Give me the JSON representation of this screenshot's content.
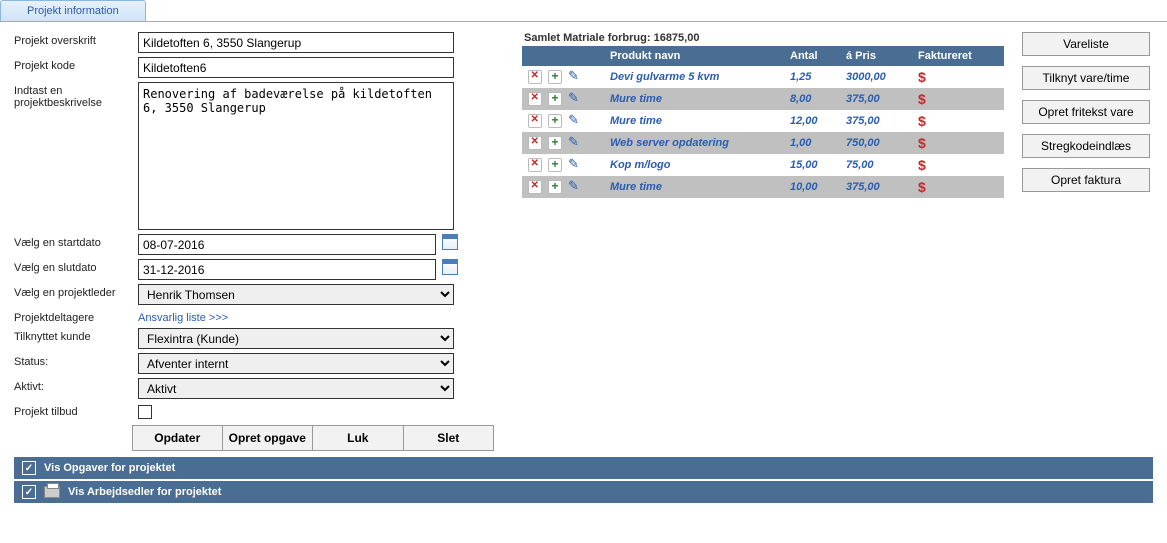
{
  "tab": {
    "label": "Projekt information"
  },
  "form": {
    "overskrift": {
      "label": "Projekt overskrift",
      "value": "Kildetoften 6, 3550 Slangerup"
    },
    "kode": {
      "label": "Projekt kode",
      "value": "Kildetoften6"
    },
    "beskrivelse": {
      "label": "Indtast en projektbeskrivelse",
      "value": "Renovering af badeværelse på kildetoften 6, 3550 Slangerup"
    },
    "startdato": {
      "label": "Vælg en startdato",
      "value": "08-07-2016"
    },
    "slutdato": {
      "label": "Vælg en slutdato",
      "value": "31-12-2016"
    },
    "leder": {
      "label": "Vælg en projektleder",
      "value": "Henrik Thomsen"
    },
    "deltagere": {
      "label": "Projektdeltagere",
      "link": "Ansvarlig liste >>>"
    },
    "kunde": {
      "label": "Tilknyttet kunde",
      "value": "Flexintra (Kunde)"
    },
    "status": {
      "label": "Status:",
      "value": "Afventer internt"
    },
    "aktivt": {
      "label": "Aktivt:",
      "value": "Aktivt"
    },
    "tilbud": {
      "label": "Projekt tilbud"
    }
  },
  "buttons": {
    "opdater": "Opdater",
    "opgave": "Opret opgave",
    "luk": "Luk",
    "slet": "Slet"
  },
  "summary": "Samlet Matriale forbrug: 16875,00",
  "table": {
    "headers": {
      "c1": "",
      "c2": "Produkt navn",
      "c3": "Antal",
      "c4": "á Pris",
      "c5": "Faktureret"
    },
    "rows": [
      {
        "navn": "Devi gulvarme 5 kvm",
        "antal": "1,25",
        "pris": "3000,00"
      },
      {
        "navn": "Mure time",
        "antal": "8,00",
        "pris": "375,00"
      },
      {
        "navn": "Mure time",
        "antal": "12,00",
        "pris": "375,00"
      },
      {
        "navn": "Web server opdatering",
        "antal": "1,00",
        "pris": "750,00"
      },
      {
        "navn": "Kop m/logo",
        "antal": "15,00",
        "pris": "75,00"
      },
      {
        "navn": "Mure time",
        "antal": "10,00",
        "pris": "375,00"
      }
    ]
  },
  "side": {
    "vareliste": "Vareliste",
    "tilknyt": "Tilknyt vare/time",
    "fritekst": "Opret fritekst vare",
    "stregkode": "Stregkodeindlæs",
    "faktura": "Opret faktura"
  },
  "panels": {
    "opgaver": "Vis Opgaver for projektet",
    "arbejdsedler": "Vis Arbejdsedler for projektet"
  }
}
